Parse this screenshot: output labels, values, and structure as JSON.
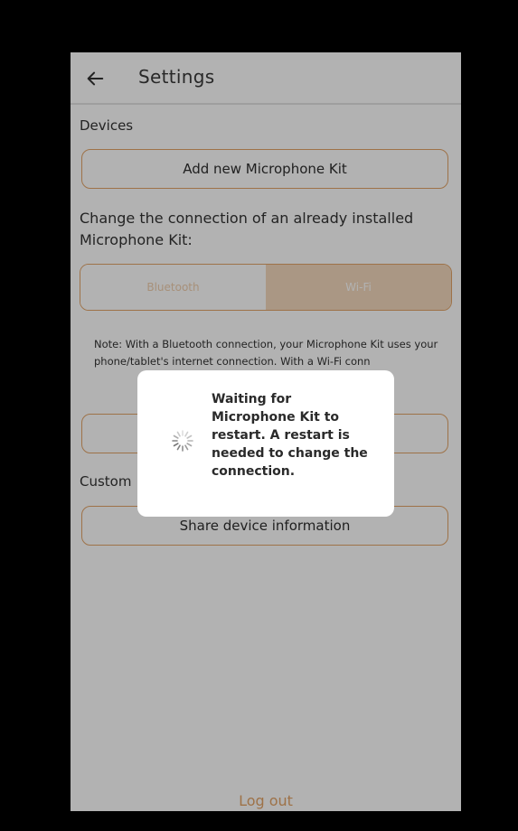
{
  "header": {
    "title": "Settings",
    "back_icon": "arrow-left-icon"
  },
  "devices": {
    "section_label": "Devices",
    "add_button_label": "Add new Microphone Kit",
    "change_connection_text": "Change the connection of an already installed Microphone Kit:",
    "connection_options": [
      "Bluetooth",
      "Wi-Fi"
    ],
    "selected_option": "Wi-Fi",
    "note_text": "Note: With a Bluetooth connection, your Microphone Kit uses your phone/tablet's internet connection. With a Wi-Fi conn"
  },
  "customer": {
    "section_label": "Custom",
    "share_button_label": "Share device information"
  },
  "footer": {
    "logout_label": "Log out"
  },
  "dialog": {
    "message": "Waiting for Microphone Kit to restart. A restart is needed to change the connection.",
    "icon": "loading-spinner-icon"
  },
  "colors": {
    "accent": "#e2a468",
    "selected_segment": "#f4d9bd",
    "overlay": "rgba(0,0,0,0.3)"
  }
}
